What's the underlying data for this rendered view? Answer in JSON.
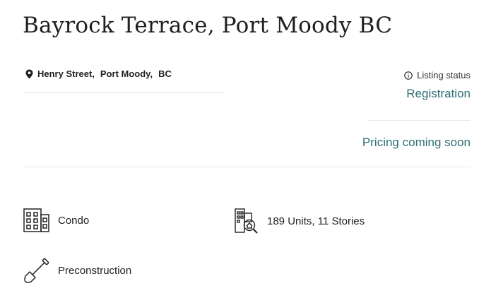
{
  "header": {
    "title": "Bayrock Terrace, Port Moody BC"
  },
  "address": {
    "street": "Henry Street,",
    "city": "Port Moody,",
    "province": "BC",
    "icon": "location-pin-icon"
  },
  "listing": {
    "status_label": "Listing status",
    "status_value": "Registration",
    "pricing": "Pricing coming soon",
    "accent_color": "#2e6f76"
  },
  "features": {
    "type": {
      "label": "Condo",
      "icon": "building-icon"
    },
    "units": {
      "label": "189 Units, 11 Stories",
      "icon": "building-search-icon"
    },
    "stage": {
      "label": "Preconstruction",
      "icon": "shovel-icon"
    }
  }
}
